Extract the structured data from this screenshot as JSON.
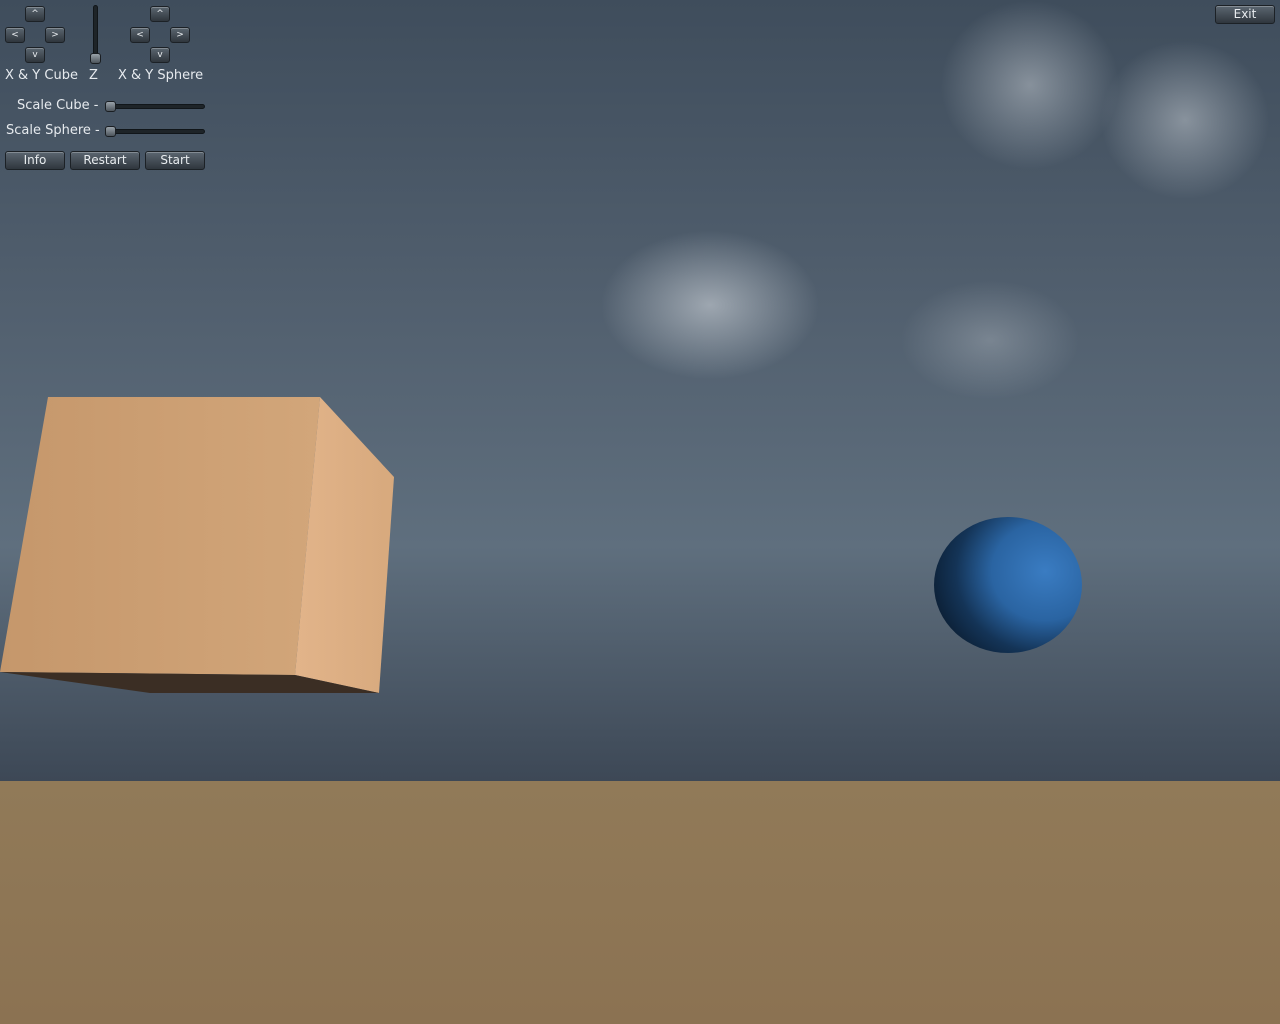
{
  "controls": {
    "cube_pad": {
      "up": "^",
      "left": "<",
      "right": ">",
      "down": "v",
      "label": "X & Y Cube"
    },
    "z_slider": {
      "label": "Z",
      "value": 0
    },
    "sphere_pad": {
      "up": "^",
      "left": "<",
      "right": ">",
      "down": "v",
      "label": "X & Y Sphere"
    },
    "scale_cube": {
      "label": "Scale Cube -",
      "value": 0
    },
    "scale_sphere": {
      "label": "Scale Sphere -",
      "value": 0
    },
    "buttons": {
      "info": "Info",
      "restart": "Restart",
      "start": "Start",
      "exit": "Exit"
    }
  },
  "scene": {
    "cube_color": "#c89a6c",
    "sphere_color": "#2a63a0",
    "ground_color": "#8d7554",
    "sky_color": "#4e5d6d"
  }
}
